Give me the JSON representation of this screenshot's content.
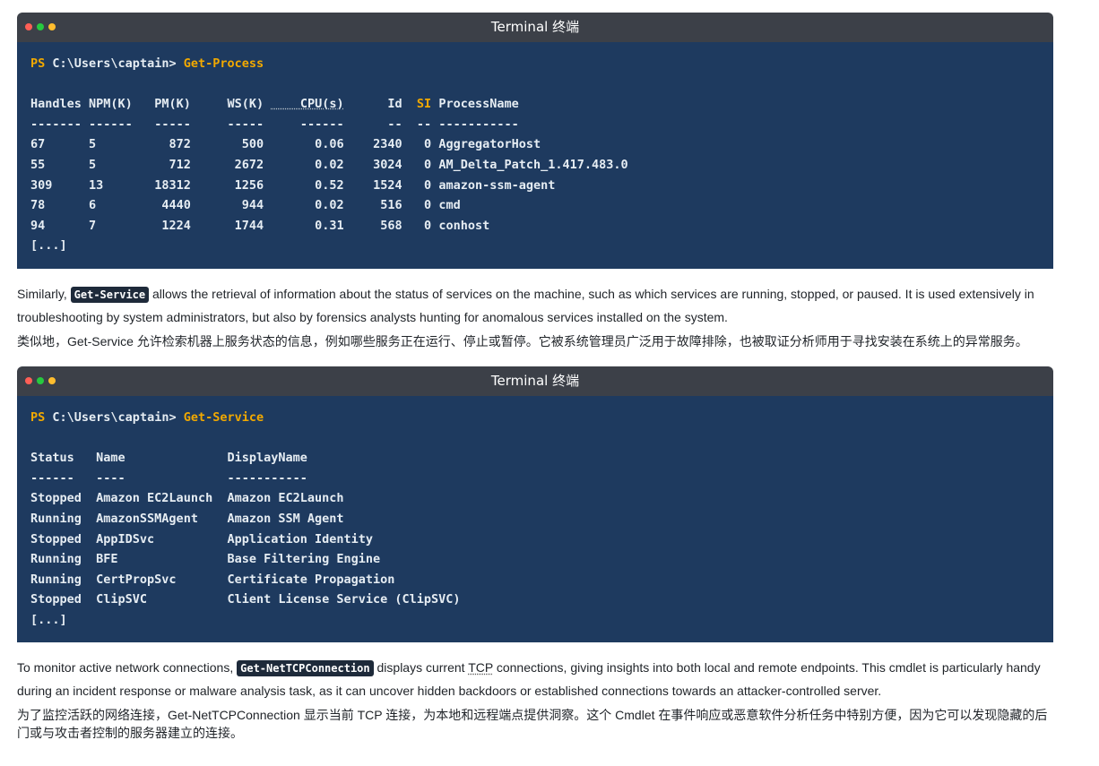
{
  "terminal1": {
    "title": "Terminal  终端",
    "prompt": "PS",
    "path": "C:\\Users\\captain>",
    "command": "Get-Process",
    "headers": [
      "Handles",
      "NPM(K)",
      "PM(K)",
      "WS(K)",
      "CPU(s)",
      "Id",
      "SI",
      "ProcessName"
    ],
    "dashes": [
      "-------",
      "------",
      "-----",
      "-----",
      "------",
      "--",
      "--",
      "-----------"
    ],
    "rows": [
      [
        "67",
        "5",
        "872",
        "500",
        "0.06",
        "2340",
        "0",
        "AggregatorHost"
      ],
      [
        "55",
        "5",
        "712",
        "2672",
        "0.02",
        "3024",
        "0",
        "AM_Delta_Patch_1.417.483.0"
      ],
      [
        "309",
        "13",
        "18312",
        "1256",
        "0.52",
        "1524",
        "0",
        "amazon-ssm-agent"
      ],
      [
        "78",
        "6",
        "4440",
        "944",
        "0.02",
        "516",
        "0",
        "cmd"
      ],
      [
        "94",
        "7",
        "1224",
        "1744",
        "0.31",
        "568",
        "0",
        "conhost"
      ]
    ],
    "ellipsis": "[...]"
  },
  "para1": {
    "en_before": "Similarly, ",
    "code": "Get-Service",
    "en_after": " allows the retrieval of information about the status of services on the machine, such as which services are running, stopped, or paused. It is used extensively in troubleshooting by system administrators, but also by forensics analysts hunting for anomalous services installed on the system.",
    "zh": "类似地，Get-Service 允许检索机器上服务状态的信息，例如哪些服务正在运行、停止或暂停。它被系统管理员广泛用于故障排除，也被取证分析师用于寻找安装在系统上的异常服务。"
  },
  "terminal2": {
    "title": "Terminal  终端",
    "prompt": "PS",
    "path": "C:\\Users\\captain>",
    "command": "Get-Service",
    "headers": [
      "Status",
      "Name",
      "DisplayName"
    ],
    "dashes": [
      "------",
      "----",
      "-----------"
    ],
    "rows": [
      [
        "Stopped",
        "Amazon EC2Launch",
        "Amazon EC2Launch"
      ],
      [
        "Running",
        "AmazonSSMAgent",
        "Amazon SSM Agent"
      ],
      [
        "Stopped",
        "AppIDSvc",
        "Application Identity"
      ],
      [
        "Running",
        "BFE",
        "Base Filtering Engine"
      ],
      [
        "Running",
        "CertPropSvc",
        "Certificate Propagation"
      ],
      [
        "Stopped",
        "ClipSVC",
        "Client License Service (ClipSVC)"
      ]
    ],
    "ellipsis": "[...]"
  },
  "para2": {
    "en_before": "To monitor active network connections, ",
    "code": "Get-NetTCPConnection",
    "en_mid1": " displays current ",
    "tcp": "TCP",
    "en_after": " connections, giving insights into both local and remote endpoints. This cmdlet is particularly handy during an incident response or malware analysis task, as it can uncover hidden backdoors or established connections towards an attacker-controlled server.",
    "zh": "为了监控活跃的网络连接，Get-NetTCPConnection 显示当前 TCP 连接，为本地和远程端点提供洞察。这个 Cmdlet 在事件响应或恶意软件分析任务中特别方便，因为它可以发现隐藏的后门或与攻击者控制的服务器建立的连接。"
  },
  "colors": {
    "terminal_bg": "#1e3a5f",
    "titlebar_bg": "#3c4048",
    "accent": "#f2a900"
  }
}
